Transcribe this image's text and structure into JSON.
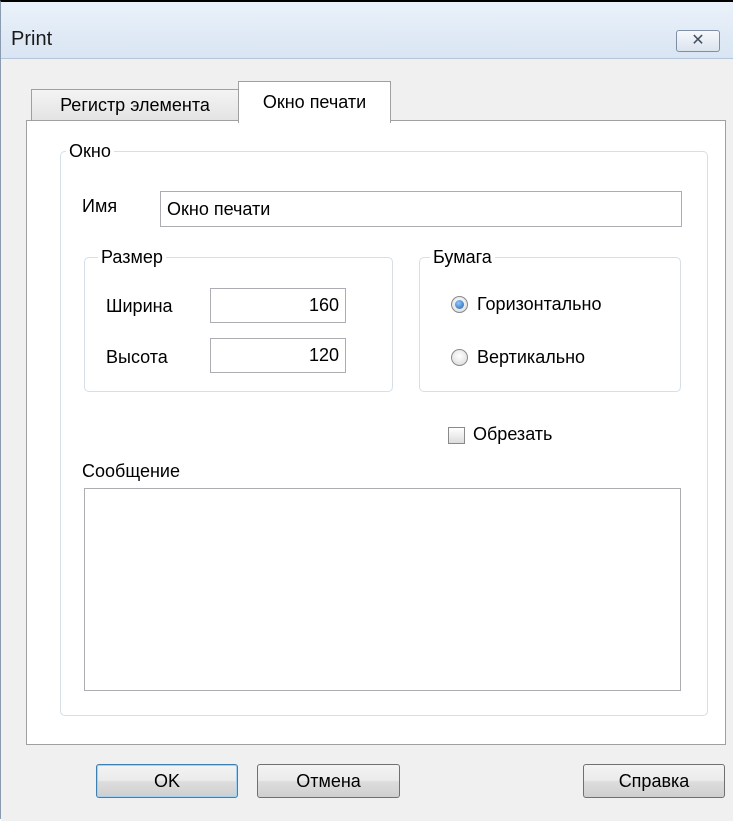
{
  "window": {
    "title": "Print",
    "close_icon": "close-icon"
  },
  "tabs": [
    {
      "label": "Регистр элемента",
      "active": false
    },
    {
      "label": "Окно печати",
      "active": true
    }
  ],
  "window_group": {
    "legend": "Окно",
    "name_label": "Имя",
    "name_value": "Окно печати"
  },
  "size_group": {
    "legend": "Размер",
    "width_label": "Ширина",
    "width_value": "160",
    "height_label": "Высота",
    "height_value": "120"
  },
  "paper_group": {
    "legend": "Бумага",
    "options": [
      {
        "label": "Горизонтально",
        "checked": true
      },
      {
        "label": "Вертикально",
        "checked": false
      }
    ]
  },
  "crop": {
    "label": "Обрезать",
    "checked": false
  },
  "message": {
    "label": "Сообщение",
    "value": ""
  },
  "buttons": {
    "ok": "OK",
    "cancel": "Отмена",
    "help": "Справка"
  },
  "colors": {
    "titlebar": "#dae6f4",
    "dialog": "#f0f0f0",
    "accent": "#3c7fb1"
  }
}
